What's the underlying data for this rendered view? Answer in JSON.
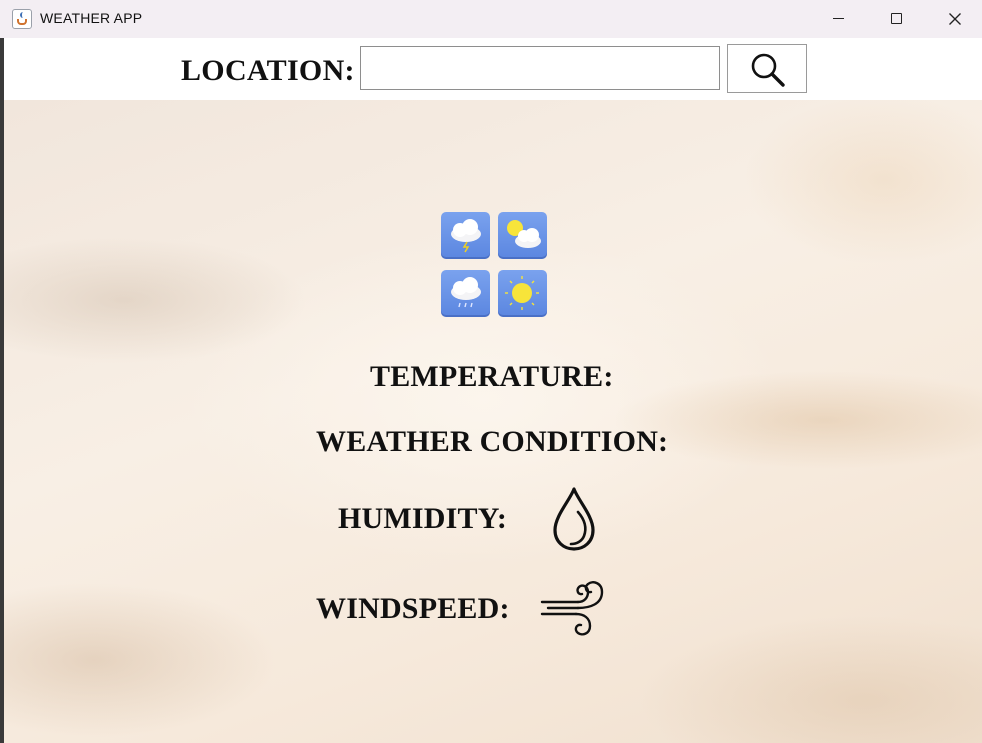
{
  "window": {
    "title": "WEATHER APP"
  },
  "search": {
    "label": "LOCATION:",
    "value": "",
    "placeholder": ""
  },
  "weather": {
    "temperature_label": "TEMPERATURE:",
    "condition_label": "WEATHER CONDITION:",
    "humidity_label": "HUMIDITY:",
    "windspeed_label": "WINDSPEED:"
  },
  "icons": {
    "app": "java-app-icon",
    "search": "magnifier-icon",
    "humidity": "water-drop-icon",
    "wind": "wind-icon",
    "weather_tiles": [
      "thunderstorm-icon",
      "partly-cloudy-icon",
      "rain-icon",
      "sunny-icon"
    ]
  },
  "colors": {
    "tile_blue": "#6a94e8",
    "background": "#f7efe6",
    "text": "#111111"
  }
}
